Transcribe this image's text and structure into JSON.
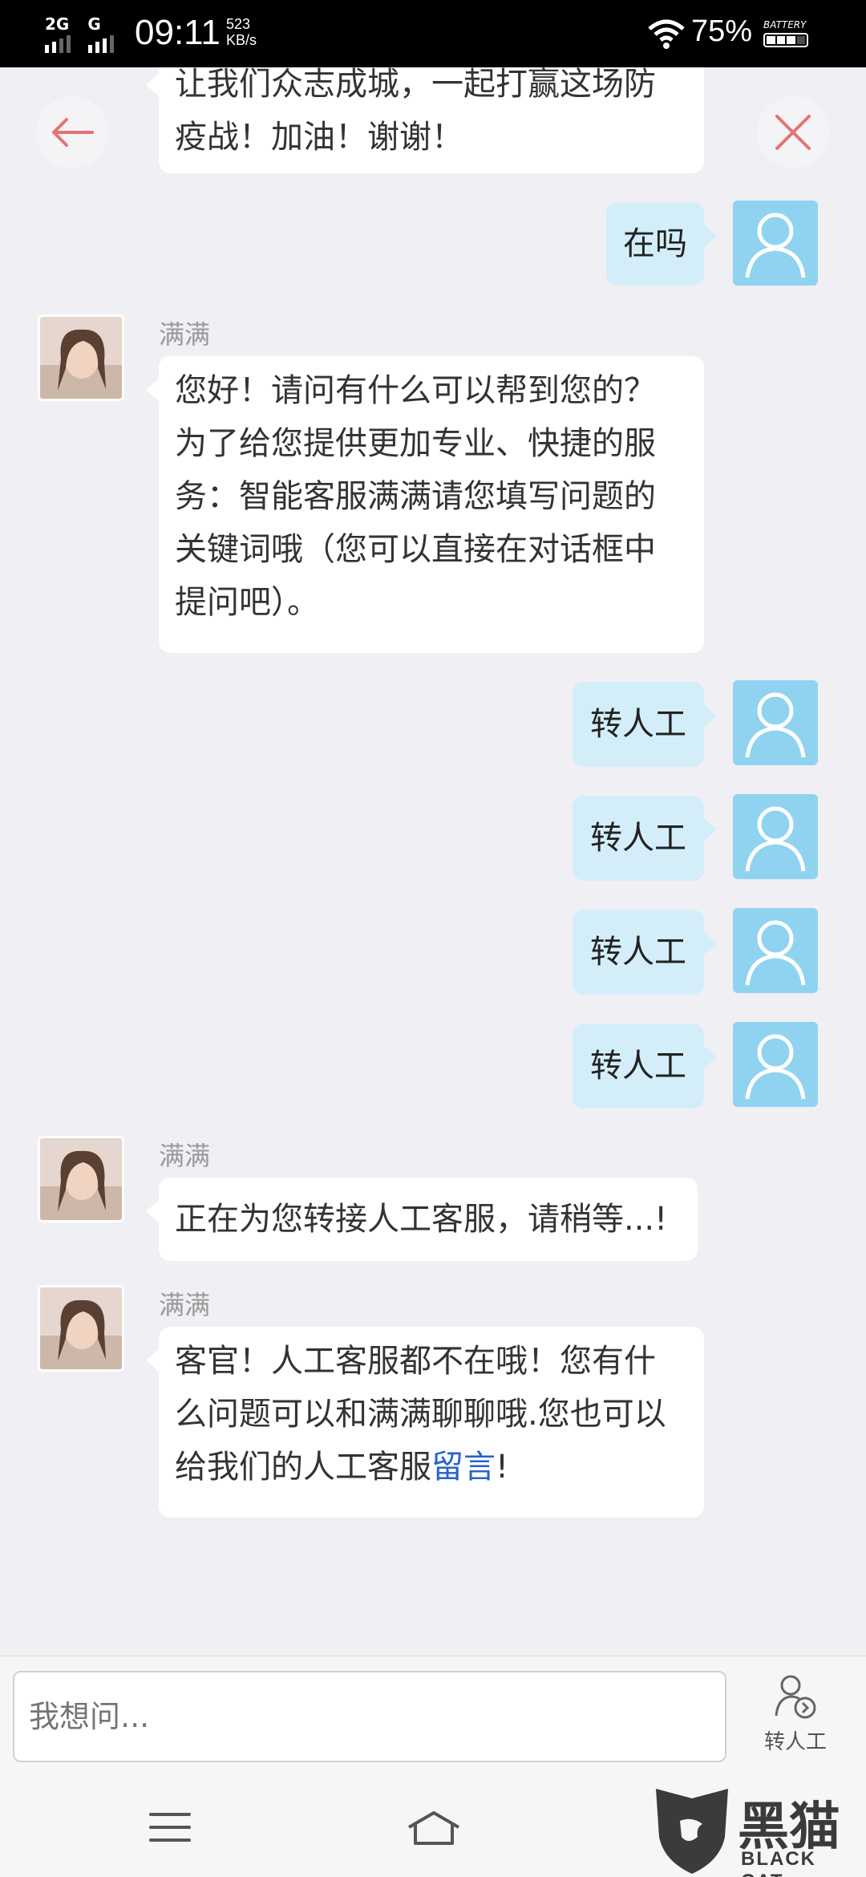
{
  "status_bar": {
    "network1": "2G",
    "network2": "G",
    "time": "09:11",
    "speed_value": "523",
    "speed_unit": "KB/s",
    "battery_percent": "75%",
    "battery_label": "BATTERY"
  },
  "header": {
    "back_icon": "arrow-left-icon",
    "close_icon": "close-x-icon"
  },
  "messages": [
    {
      "side": "left",
      "text_lines": [
        "让我们众志成城，一起打赢这场防",
        "疫战！加油！谢谢！"
      ]
    },
    {
      "side": "right",
      "text": "在吗"
    },
    {
      "side": "left",
      "name": "满满",
      "text_lines": [
        "您好！请问有什么可以帮到您的？",
        "为了给您提供更加专业、快捷的服",
        "务：智能客服满满请您填写问题的",
        "关键词哦（您可以直接在对话框中",
        "提问吧）。"
      ]
    },
    {
      "side": "right",
      "text": "转人工"
    },
    {
      "side": "right",
      "text": "转人工"
    },
    {
      "side": "right",
      "text": "转人工"
    },
    {
      "side": "right",
      "text": "转人工"
    },
    {
      "side": "left",
      "name": "满满",
      "text": "正在为您转接人工客服，请稍等...!"
    },
    {
      "side": "left",
      "name": "满满",
      "text_lines": [
        "客官！人工客服都不在哦！您有什",
        "么问题可以和满满聊聊哦.您也可以",
        "给我们的人工客服"
      ],
      "link": "留言",
      "suffix": "!"
    }
  ],
  "input": {
    "placeholder": "我想问..."
  },
  "transfer_button": {
    "label": "转人工"
  },
  "watermark": {
    "text": "黑猫",
    "sub": "BLACK CAT"
  },
  "colors": {
    "background": "#efeff4",
    "user_bubble": "#d3eef9",
    "user_avatar": "#8fd3f0",
    "link": "#2a62c9",
    "accent_red": "#e57373"
  }
}
